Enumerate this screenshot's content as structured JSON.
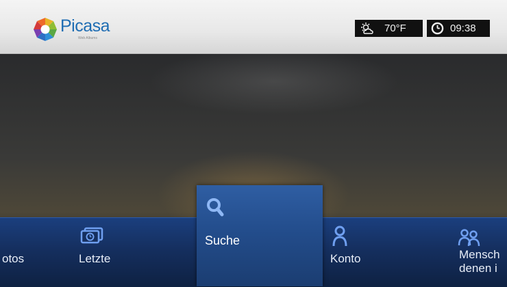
{
  "app": {
    "logo_text": "Picasa",
    "logo_subtitle": "Web Albums"
  },
  "status": {
    "weather_icon": "weather-cloudy-sun-icon",
    "temperature": "70°F",
    "clock_icon": "clock-icon",
    "time": "09:38"
  },
  "menu": {
    "items": [
      {
        "label": "otos",
        "icon": "",
        "selected": false
      },
      {
        "label": "Letzte",
        "icon": "recent-photos-icon",
        "selected": false
      },
      {
        "label": "Suche",
        "icon": "search-icon",
        "selected": true
      },
      {
        "label": "Konto",
        "icon": "account-icon",
        "selected": false
      },
      {
        "label": "Mensch",
        "label_line2": "denen i",
        "icon": "people-icon",
        "selected": false
      }
    ]
  },
  "colors": {
    "menu_bar": "#152f5f",
    "selected_tile": "#2f5ea3",
    "icon_blue": "#6f9ff0",
    "logo_text": "#1f6db3"
  }
}
